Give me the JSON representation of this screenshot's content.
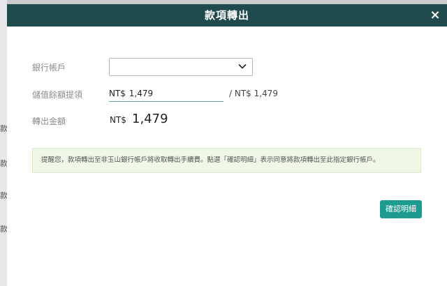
{
  "modal": {
    "title": "款項轉出",
    "close_label": "×"
  },
  "form": {
    "bank_account_label": "銀行帳戶",
    "bank_account_value": "",
    "withdraw_label": "儲值餘額提領",
    "withdraw_currency": "NT$",
    "withdraw_value": "1,479",
    "max_text": "/ NT$ 1,479",
    "transfer_label": "轉出金額",
    "transfer_currency": "NT$",
    "transfer_value": "1,479"
  },
  "notice": {
    "text": "提醒您，款項轉出至非玉山銀行帳戶將收取轉出手續費。點選「確認明細」表示同意將款項轉出至此指定銀行帳戶。"
  },
  "actions": {
    "confirm_label": "確認明細"
  },
  "background": {
    "fragments": [
      "款",
      "款",
      "款",
      "款"
    ]
  },
  "colors": {
    "header": "#1f4b4f",
    "accent": "#1e9b8f",
    "notice_bg": "#eff7e6"
  },
  "icons": {
    "close": "close-icon",
    "dropdown": "chevron-down-icon"
  }
}
